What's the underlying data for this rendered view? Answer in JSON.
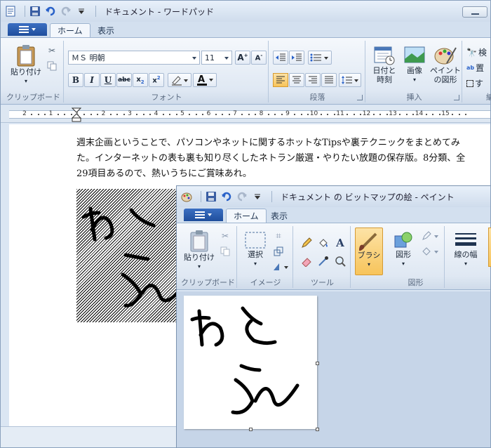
{
  "wordpad": {
    "title": "ドキュメント - ワードパッド",
    "tabs": [
      "ホーム",
      "表示"
    ],
    "clipboard": {
      "paste_label": "貼り付け",
      "group_label": "クリップボード"
    },
    "font": {
      "family": "ＭＳ 明朝",
      "size": "11",
      "group_label": "フォント"
    },
    "paragraph": {
      "group_label": "段落"
    },
    "insert": {
      "datetime_label": "日付と\n時刻",
      "picture_label": "画像",
      "paint_label": "ペイント\nの図形",
      "group_label": "挿入"
    },
    "editing": {
      "find_label": "検",
      "replace_label": "置",
      "select_label": "す",
      "group_label": "編"
    },
    "ruler_ticks": [
      "2",
      "1",
      "1",
      "2",
      "3",
      "4",
      "5",
      "6",
      "7",
      "8",
      "9",
      "10",
      "11",
      "12",
      "13",
      "14",
      "15"
    ],
    "document_text": "週末企画ということで、パソコンやネットに関するホットなTipsや裏テクニックをまとめてみた。インターネットの表も裏も知り尽くしたネトラン厳選・やりたい放題の保存版。8分類、全29項目あるので、熱いうちにご賞味あれ。"
  },
  "paint": {
    "title": "ドキュメント の ビットマップの絵 - ペイント",
    "tabs": [
      "ホーム",
      "表示"
    ],
    "clipboard": {
      "paste_label": "貼り付け",
      "group_label": "クリップボード"
    },
    "image": {
      "select_label": "選択",
      "group_label": "イメージ"
    },
    "tools": {
      "group_label": "ツール"
    },
    "brush_label": "ブラシ",
    "shapes": {
      "shape_label": "図形",
      "group_label": "図形"
    },
    "size_label": "線の幅"
  },
  "colors": {
    "accent": "#1f4e9c",
    "highlight": "#f7c45b",
    "ribbon": "#dfe8f3"
  }
}
